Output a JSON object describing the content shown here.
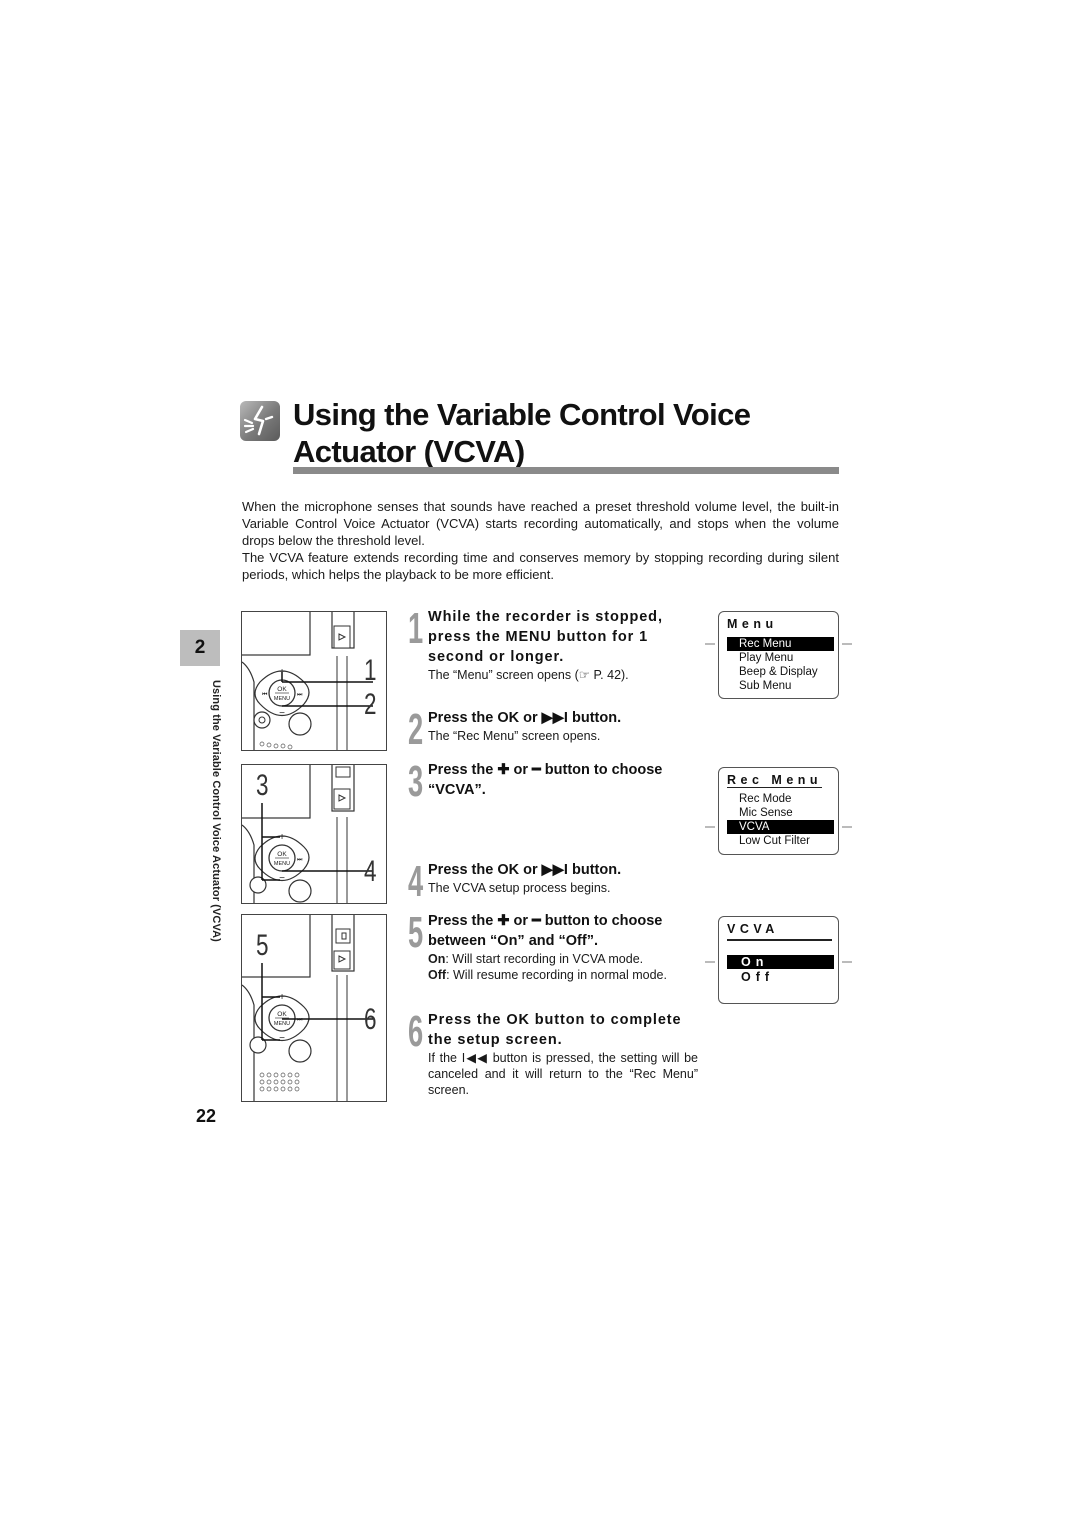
{
  "header": {
    "icon": "vcva-voice-actuator-icon",
    "title_line1": "Using the Variable Control Voice",
    "title_line2": "Actuator (VCVA)"
  },
  "intro": {
    "para1": "When the microphone senses that sounds have reached a preset threshold volume level, the built-in Variable Control Voice Actuator (VCVA) starts recording automatically, and stops when the volume drops below the threshold level.",
    "para2": "The VCVA feature extends recording time and conserves memory by stopping recording during silent periods, which helps the playback to be more efficient."
  },
  "sidebar": {
    "chapter": "2",
    "section_label": "Using the Variable Control Voice Actuator (VCVA)",
    "page_number": "22"
  },
  "illustrations": [
    {
      "callouts": [
        "1",
        "2"
      ]
    },
    {
      "callouts": [
        "3",
        "4"
      ]
    },
    {
      "callouts": [
        "5",
        "6"
      ]
    }
  ],
  "device_labels": {
    "ok": "OK",
    "menu": "MENU",
    "plus": "+",
    "minus": "−",
    "prev": "⏮",
    "next": "⏭"
  },
  "steps": [
    {
      "num": "1",
      "title": "While the recorder is stopped, press the MENU button for 1 second or longer.",
      "desc": "The “Menu” screen opens (☞ P. 42)."
    },
    {
      "num": "2",
      "title": "Press the OK or ▶▶I button.",
      "desc": "The “Rec Menu” screen opens."
    },
    {
      "num": "3",
      "title": "Press the ✚ or ━ button to choose “VCVA”.",
      "desc": ""
    },
    {
      "num": "4",
      "title": "Press the OK or ▶▶I button.",
      "desc": "The VCVA setup process begins."
    },
    {
      "num": "5",
      "title": "Press the ✚ or ━ button to choose between “On” and “Off”.",
      "desc_on_label": "On",
      "desc_on": ": Will start recording in VCVA mode.",
      "desc_off_label": "Off",
      "desc_off": ": Will resume recording in normal mode."
    },
    {
      "num": "6",
      "title": "Press the OK button to complete the setup screen.",
      "desc": "If the I◀◀ button is pressed, the setting will be canceled and it will return to the “Rec Menu” screen."
    }
  ],
  "screens": [
    {
      "title": "Menu",
      "items": [
        "Rec Menu",
        "Play Menu",
        "Beep & Display",
        "Sub Menu"
      ],
      "selected": "Rec Menu"
    },
    {
      "title": "Rec Menu",
      "items": [
        "Rec Mode",
        "Mic Sense",
        "VCVA",
        "Low Cut Filter"
      ],
      "selected": "VCVA"
    },
    {
      "title": "VCVA",
      "items": [
        "On",
        "Off"
      ],
      "selected": "On"
    }
  ]
}
